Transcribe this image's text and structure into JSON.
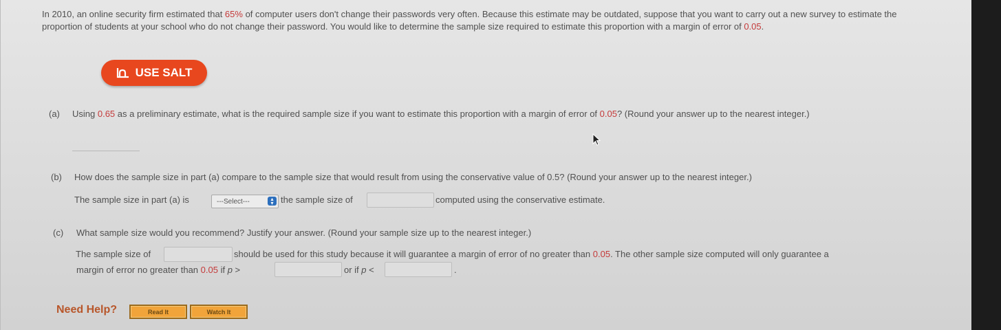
{
  "intro": {
    "part1": "In 2010, an online security firm estimated that ",
    "pct": "65%",
    "part2": " of computer users don't change their passwords very often. Because this estimate may be outdated, suppose that you want to carry out a new survey to estimate the proportion of students at your school who do not change their password. You would like to determine the sample size required to estimate this proportion with a margin of error of ",
    "moe": "0.05",
    "end": "."
  },
  "salt_button": {
    "label": "USE SALT"
  },
  "part_a": {
    "letter": "(a)",
    "q1": "Using ",
    "est": "0.65",
    "q2": " as a preliminary estimate, what is the required sample size if you want to estimate this proportion with a margin of error of ",
    "moe": "0.05",
    "q3": "? (Round your answer up to the nearest integer.)"
  },
  "part_b": {
    "letter": "(b)",
    "question": "How does the sample size in part (a) compare to the sample size that would result from using the conservative value of 0.5? (Round your answer up to the nearest integer.)",
    "s1": "The sample size in part (a) is",
    "select_value": "---Select---",
    "s2": "the sample size of",
    "s3": "computed using the conservative estimate."
  },
  "part_c": {
    "letter": "(c)",
    "question": "What sample size would you recommend? Justify your answer. (Round your sample size up to the nearest integer.)",
    "s1": "The sample size of",
    "s2": "should be used for this study because it will guarantee a margin of error of no greater than ",
    "moe1": "0.05",
    "s3": ". The other sample size computed will only guarantee a",
    "s4": "margin of error no greater than ",
    "moe2": "0.05",
    "s5": " if ",
    "p1": "p",
    "gt": " >",
    "s6": "or if ",
    "p2": "p",
    "lt": " <",
    "end": "."
  },
  "help": {
    "label": "Need Help?",
    "read_label": "Read It",
    "watch_label": "Watch It"
  },
  "colors": {
    "accent_red": "#c43a3a",
    "salt_orange": "#e8471e",
    "help_orange": "#f1a43a"
  }
}
